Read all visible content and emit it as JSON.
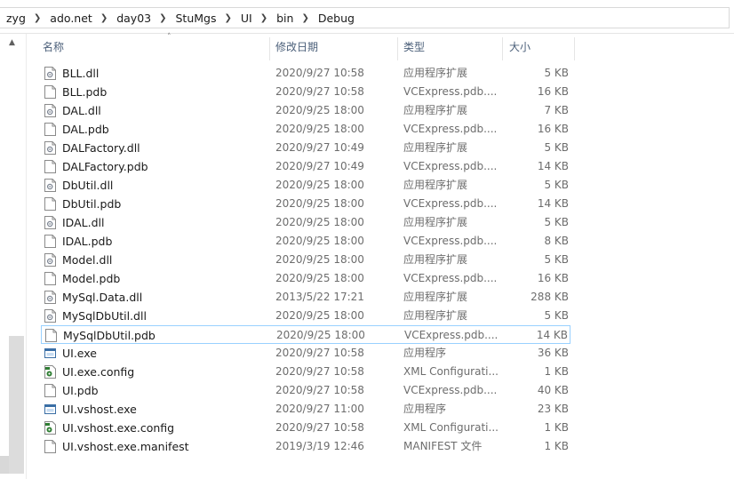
{
  "breadcrumb": [
    "zyg",
    "ado.net",
    "day03",
    "StuMgs",
    "UI",
    "bin",
    "Debug"
  ],
  "columns": {
    "name": "名称",
    "date": "修改日期",
    "type": "类型",
    "size": "大小"
  },
  "files": [
    {
      "name": "BLL.dll",
      "date": "2020/9/27 10:58",
      "type": "应用程序扩展",
      "size": "5 KB",
      "icon": "dll-icon"
    },
    {
      "name": "BLL.pdb",
      "date": "2020/9/27 10:58",
      "type": "VCExpress.pdb....",
      "size": "16 KB",
      "icon": "file-icon"
    },
    {
      "name": "DAL.dll",
      "date": "2020/9/25 18:00",
      "type": "应用程序扩展",
      "size": "7 KB",
      "icon": "dll-icon"
    },
    {
      "name": "DAL.pdb",
      "date": "2020/9/25 18:00",
      "type": "VCExpress.pdb....",
      "size": "16 KB",
      "icon": "file-icon"
    },
    {
      "name": "DALFactory.dll",
      "date": "2020/9/27 10:49",
      "type": "应用程序扩展",
      "size": "5 KB",
      "icon": "dll-icon"
    },
    {
      "name": "DALFactory.pdb",
      "date": "2020/9/27 10:49",
      "type": "VCExpress.pdb....",
      "size": "14 KB",
      "icon": "file-icon"
    },
    {
      "name": "DbUtil.dll",
      "date": "2020/9/25 18:00",
      "type": "应用程序扩展",
      "size": "5 KB",
      "icon": "dll-icon"
    },
    {
      "name": "DbUtil.pdb",
      "date": "2020/9/25 18:00",
      "type": "VCExpress.pdb....",
      "size": "14 KB",
      "icon": "file-icon"
    },
    {
      "name": "IDAL.dll",
      "date": "2020/9/25 18:00",
      "type": "应用程序扩展",
      "size": "5 KB",
      "icon": "dll-icon"
    },
    {
      "name": "IDAL.pdb",
      "date": "2020/9/25 18:00",
      "type": "VCExpress.pdb....",
      "size": "8 KB",
      "icon": "file-icon"
    },
    {
      "name": "Model.dll",
      "date": "2020/9/25 18:00",
      "type": "应用程序扩展",
      "size": "5 KB",
      "icon": "dll-icon"
    },
    {
      "name": "Model.pdb",
      "date": "2020/9/25 18:00",
      "type": "VCExpress.pdb....",
      "size": "16 KB",
      "icon": "file-icon"
    },
    {
      "name": "MySql.Data.dll",
      "date": "2013/5/22 17:21",
      "type": "应用程序扩展",
      "size": "288 KB",
      "icon": "dll-icon"
    },
    {
      "name": "MySqlDbUtil.dll",
      "date": "2020/9/25 18:00",
      "type": "应用程序扩展",
      "size": "5 KB",
      "icon": "dll-icon"
    },
    {
      "name": "MySqlDbUtil.pdb",
      "date": "2020/9/25 18:00",
      "type": "VCExpress.pdb....",
      "size": "14 KB",
      "icon": "file-icon",
      "selected": true
    },
    {
      "name": "UI.exe",
      "date": "2020/9/27 10:58",
      "type": "应用程序",
      "size": "36 KB",
      "icon": "exe-icon"
    },
    {
      "name": "UI.exe.config",
      "date": "2020/9/27 10:58",
      "type": "XML Configurati...",
      "size": "1 KB",
      "icon": "config-icon"
    },
    {
      "name": "UI.pdb",
      "date": "2020/9/27 10:58",
      "type": "VCExpress.pdb....",
      "size": "40 KB",
      "icon": "file-icon"
    },
    {
      "name": "UI.vshost.exe",
      "date": "2020/9/27 11:00",
      "type": "应用程序",
      "size": "23 KB",
      "icon": "exe-icon"
    },
    {
      "name": "UI.vshost.exe.config",
      "date": "2020/9/27 10:58",
      "type": "XML Configurati...",
      "size": "1 KB",
      "icon": "config-icon"
    },
    {
      "name": "UI.vshost.exe.manifest",
      "date": "2019/3/19 12:46",
      "type": "MANIFEST 文件",
      "size": "1 KB",
      "icon": "file-icon"
    }
  ],
  "colors": {
    "header_text": "#4c607a",
    "selection_border": "#99d1ff",
    "detail_text": "#6d6d6d"
  }
}
